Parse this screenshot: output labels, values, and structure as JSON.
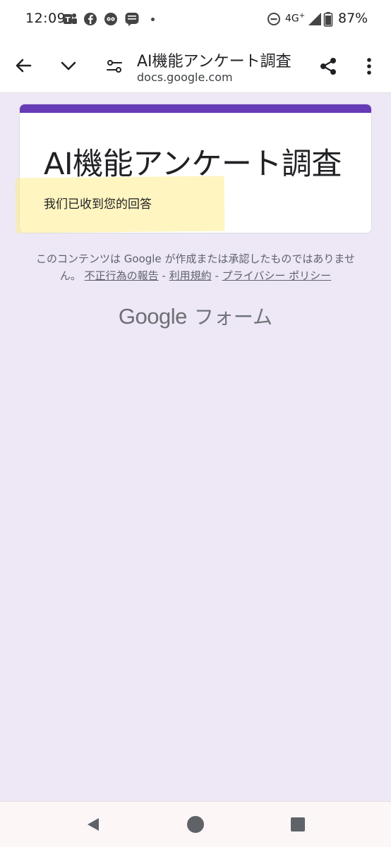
{
  "status_bar": {
    "time": "12:09",
    "network": "4G",
    "network_suffix": "+",
    "battery": "87%",
    "notification_icons": [
      "teams-icon",
      "facebook-icon",
      "chat-bubble-icon",
      "line-manga-icon"
    ],
    "system_icons": [
      "do-not-disturb-icon",
      "signal-icon",
      "battery-icon"
    ]
  },
  "toolbar": {
    "page_title": "AI機能アンケート調査",
    "url": "docs.google.com",
    "icons": [
      "back-arrow-icon",
      "chevron-down-icon",
      "page-settings-icon",
      "share-icon",
      "more-vert-icon"
    ]
  },
  "form": {
    "accent_color": "#673ab7",
    "title": "AI機能アンケート調査",
    "response_message": "我们已收到您的回答",
    "highlight_color": "#fff3b0"
  },
  "disclaimer": {
    "text": "このコンテンツは Google が作成または承認したものではありません。",
    "link_abuse": "不正行為の報告",
    "separator": "-",
    "link_terms": "利用規約",
    "link_privacy": "プライバシー ポリシー"
  },
  "brand": {
    "google": "Google",
    "forms": "フォーム"
  },
  "navbar": {
    "icons": [
      "back-triangle-icon",
      "home-circle-icon",
      "recents-square-icon"
    ]
  },
  "colors": {
    "background": "#ede7f6",
    "accent": "#673ab7",
    "text_secondary": "#5f6368"
  }
}
